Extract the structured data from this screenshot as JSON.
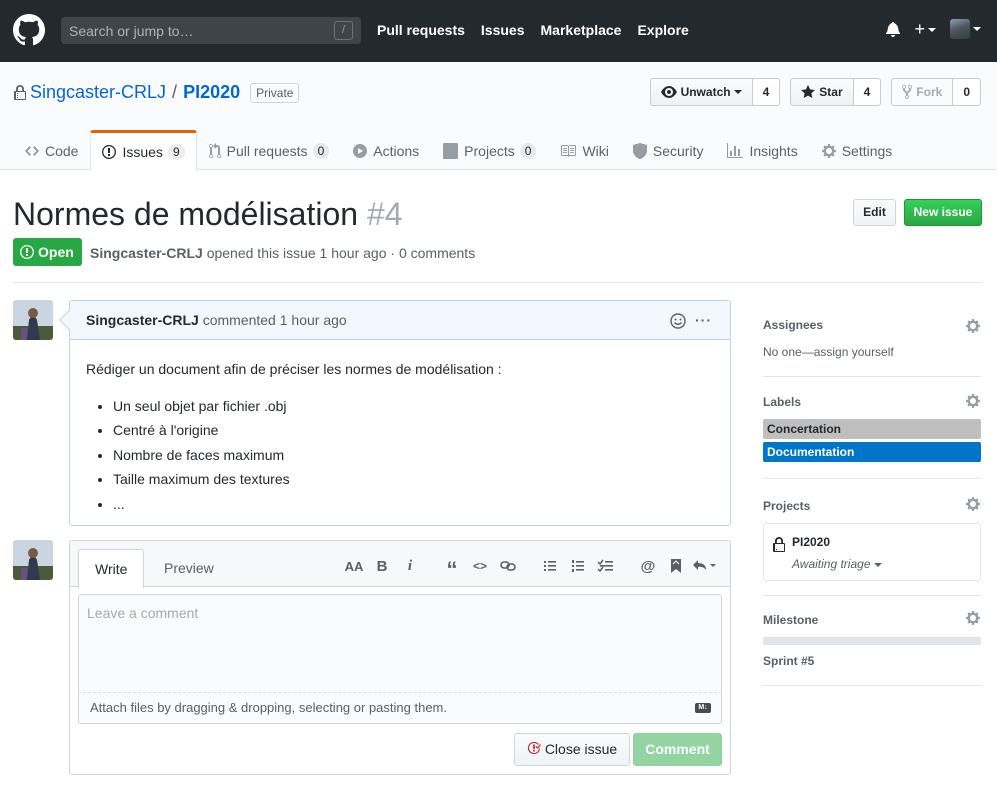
{
  "header": {
    "search_placeholder": "Search or jump to…",
    "search_shortcut": "/",
    "nav": [
      "Pull requests",
      "Issues",
      "Marketplace",
      "Explore"
    ],
    "plus": "+"
  },
  "repo": {
    "owner": "Singcaster-CRLJ",
    "separator": "/",
    "name": "PI2020",
    "visibility": "Private",
    "watch_label": "Unwatch",
    "watch_count": "4",
    "star_label": "Star",
    "star_count": "4",
    "fork_label": "Fork",
    "fork_count": "0",
    "tabs": [
      {
        "label": "Code",
        "count": ""
      },
      {
        "label": "Issues",
        "count": "9"
      },
      {
        "label": "Pull requests",
        "count": "0"
      },
      {
        "label": "Actions",
        "count": ""
      },
      {
        "label": "Projects",
        "count": "0"
      },
      {
        "label": "Wiki",
        "count": ""
      },
      {
        "label": "Security",
        "count": ""
      },
      {
        "label": "Insights",
        "count": ""
      },
      {
        "label": "Settings",
        "count": ""
      }
    ]
  },
  "issue": {
    "title": "Normes de modélisation",
    "number": "#4",
    "state": "Open",
    "author": "Singcaster-CRLJ",
    "meta_text": "opened this issue 1 hour ago · 0 comments",
    "edit_label": "Edit",
    "new_issue_label": "New issue"
  },
  "comment": {
    "author": "Singcaster-CRLJ",
    "meta": "commented 1 hour ago",
    "menu": "···",
    "intro": "Rédiger un document afin de préciser les normes de modélisation :",
    "items": [
      "Un seul objet par fichier .obj",
      "Centré à l'origine",
      "Nombre de faces maximum",
      "Taille maximum des textures",
      "..."
    ]
  },
  "new_comment": {
    "tab_write": "Write",
    "tab_preview": "Preview",
    "placeholder": "Leave a comment",
    "attach_text": "Attach files by dragging & dropping, selecting or pasting them.",
    "md_badge": "M↓",
    "close_issue_label": "Close issue",
    "comment_label": "Comment",
    "toolbar": [
      "AA",
      "B",
      "i",
      "“",
      "<>",
      "link",
      "ul",
      "ol",
      "task",
      "@",
      "bookmark",
      "reply"
    ]
  },
  "sidebar": {
    "assignees_heading": "Assignees",
    "assignees_text": "No one—assign yourself",
    "labels_heading": "Labels",
    "labels": [
      {
        "name": "Concertation",
        "color": "#bfbfbf",
        "text_color": "#24292e"
      },
      {
        "name": "Documentation",
        "color": "#0075ca",
        "text_color": "#ffffff"
      }
    ],
    "projects_heading": "Projects",
    "project_name": "PI2020",
    "project_status": "Awaiting triage",
    "milestone_heading": "Milestone",
    "milestone_name": "Sprint #5",
    "milestone_progress": 0
  },
  "colors": {
    "open_green": "#28a745",
    "active_tab_accent": "#e36209",
    "link_blue": "#0366d6",
    "header_bg": "#24292e"
  }
}
